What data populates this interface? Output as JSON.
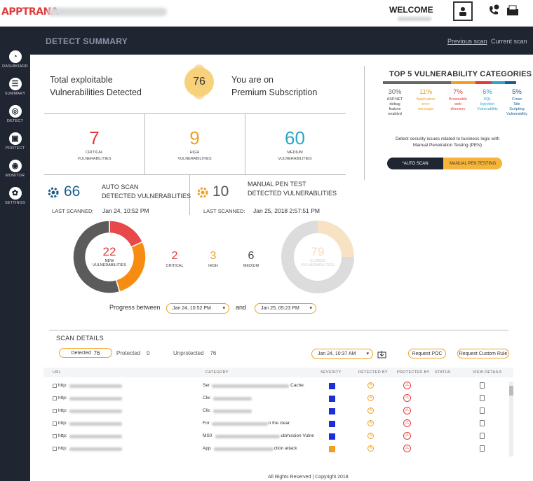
{
  "topbar": {
    "logo_a": "APP",
    "logo_b": "TRANA",
    "welcome": "WELCOME",
    "user_icon": "user-icon",
    "phone_icon": "phone-chat-icon",
    "folder_icon": "folder-icon"
  },
  "sidebar": {
    "items": [
      {
        "label": "DASHBOARD",
        "icon": "dashboard-icon",
        "glyph": "◔"
      },
      {
        "label": "SUMMARY",
        "icon": "list-icon",
        "glyph": "☰"
      },
      {
        "label": "DETECT",
        "icon": "detect-icon",
        "glyph": "◎"
      },
      {
        "label": "PROTECT",
        "icon": "lock-icon",
        "glyph": "▣"
      },
      {
        "label": "MONITOR",
        "icon": "monitor-icon",
        "glyph": "◉"
      },
      {
        "label": "SETTINGS",
        "icon": "gear-icon",
        "glyph": "✿"
      }
    ]
  },
  "header": {
    "title": "DETECT SUMMARY",
    "previous_scan": "Previous scan",
    "current_scan": "Current scan"
  },
  "summary": {
    "total_line1": "Total exploitable",
    "total_line2": "Vulnerabilities Detected",
    "total_count": "76",
    "plan_line1": "You are on",
    "plan_line2": "Premium Subscription"
  },
  "counters": [
    {
      "value": "7",
      "line1": "CRITICAL",
      "line2": "VULNERABILITIES",
      "color": "#e23b3b"
    },
    {
      "value": "9",
      "line1": "HIGH",
      "line2": "VULNERABILITIES",
      "color": "#f0a020"
    },
    {
      "value": "60",
      "line1": "MEDIUM",
      "line2": "VULNERABILITIES",
      "color": "#2aa6c8"
    }
  ],
  "auto_scan": {
    "count": "66",
    "title1": "AUTO SCAN",
    "title2": "DETECTED VULNERABLITIES",
    "last_label": "LAST SCANNED:",
    "last_value": "Jan 24, 10:52 PM"
  },
  "manual_scan": {
    "count": "10",
    "title1": "MANUAL PEN TEST",
    "title2": "DETECTED VULNERABLITIES",
    "last_label": "LAST SCANNED:",
    "last_value": "Jan 25, 2018 2:57:51 PM"
  },
  "new_vulns": {
    "total": "22",
    "line1": "NEW",
    "line2": "VULNERABILITIES",
    "critical": "2",
    "critical_label": "CRITICAL",
    "high": "3",
    "high_label": "HIGH",
    "medium": "6",
    "medium_label": "MEDIUM",
    "segments": [
      {
        "name": "critical",
        "value": 2,
        "color": "#e8484a"
      },
      {
        "name": "high",
        "value": 3,
        "color": "#f78c12"
      },
      {
        "name": "medium",
        "value": 6,
        "color": "#5b5b5b"
      }
    ]
  },
  "closed_vulns": {
    "total": "79",
    "line1": "CLOSED",
    "line2": "VULNERABILITIES",
    "fraction_closed": 0.25
  },
  "progress": {
    "label": "Progress between",
    "from": "Jan 24, 10:52 PM",
    "and": "and",
    "to": "Jan 25, 05:23 PM"
  },
  "top5": {
    "title": "TOP 5 VULNERABILITY CATEGORIES",
    "categories": [
      {
        "pct": "30%",
        "desc": [
          "ASP.NET",
          "debug",
          "feature",
          "enabled"
        ],
        "color": "#666666",
        "fraction": 0.3
      },
      {
        "pct": "11%",
        "desc": [
          "Application",
          "error",
          "message"
        ],
        "color": "#f0a020",
        "fraction": 0.11
      },
      {
        "pct": "7%",
        "desc": [
          "Browsable",
          "web",
          "directory"
        ],
        "color": "#e23b3b",
        "fraction": 0.07
      },
      {
        "pct": "6%",
        "desc": [
          "SQL",
          "Injection",
          "Vulnerability"
        ],
        "color": "#2aa6c8",
        "fraction": 0.06
      },
      {
        "pct": "5%",
        "desc": [
          "Cross",
          "Site",
          "Scripting",
          "Vulnerability"
        ],
        "color": "#1c5d8c",
        "fraction": 0.05
      }
    ],
    "pen_desc_1": "Detect security issues related to business logic with",
    "pen_desc_2": "Manual Penetration Testing (PEN)",
    "toggle_auto": "*AUTO SCAN",
    "toggle_manual": "MANUAL PEN TESTING"
  },
  "scan_details": {
    "title": "SCAN DETAILS",
    "detected_label": "Detected",
    "detected_count": "76",
    "protected_label": "Protected",
    "protected_count": "0",
    "unprotected_label": "Unprotected",
    "unprotected_count": "76",
    "scan_date": "Jan 24, 10:37 AM",
    "request_poc": "Request POC",
    "request_rule": "Request Custom Rule",
    "columns": [
      "URL",
      "CATEGORY",
      "SEVERITY",
      "DETECTED BY",
      "PROTECTED BY",
      "STATUS",
      "VIEW DETAILS"
    ],
    "rows": [
      {
        "url": "http:",
        "cat_pre": "Ser",
        "cat_post": "Cache.",
        "severity_color": "#1a2fd8"
      },
      {
        "url": "http:",
        "cat_pre": "Clic",
        "cat_post": "",
        "severity_color": "#1a2fd8"
      },
      {
        "url": "http:",
        "cat_pre": "Clic",
        "cat_post": "",
        "severity_color": "#1a2fd8"
      },
      {
        "url": "http:",
        "cat_pre": "For",
        "cat_post": "n the clear",
        "severity_color": "#1a2fd8"
      },
      {
        "url": "http:",
        "cat_pre": "MS0",
        "cat_post": "ubmission Vulne",
        "severity_color": "#1a2fd8"
      },
      {
        "url": "http:",
        "cat_pre": "App",
        "cat_post": "ction attack",
        "severity_color": "#f0a020"
      }
    ]
  },
  "footer": "All Rights Reserved | Copyright 2018"
}
